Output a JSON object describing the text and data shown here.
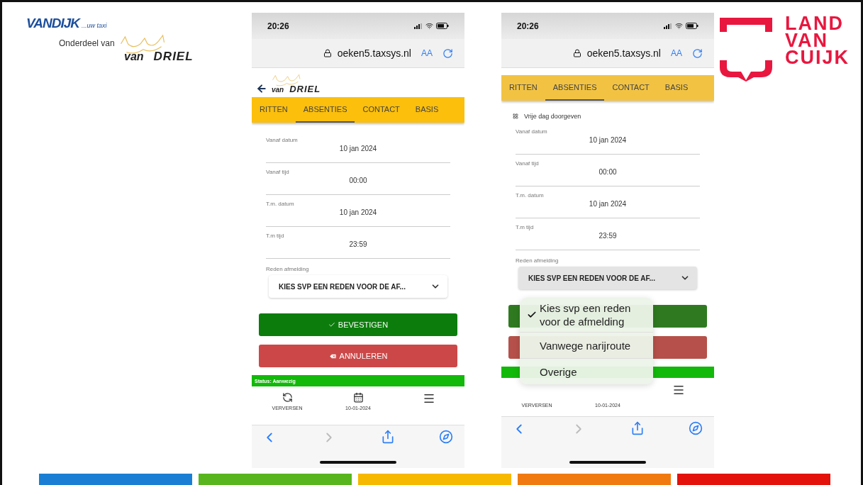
{
  "logo_left": {
    "brand": "VANDIJK",
    "tagline": "...uw taxi",
    "subtitle": "Onderdeel van",
    "partner_prefix": "van",
    "partner_name": "DRIEL"
  },
  "phones": [
    {
      "time": "20:26",
      "url": "oeken5.taxsys.nl",
      "text_size": "AA",
      "header": {
        "prefix": "van",
        "name": "DRIEL"
      },
      "tabs": [
        {
          "label": "RITTEN",
          "selected": false
        },
        {
          "label": "ABSENTIES",
          "selected": true
        },
        {
          "label": "CONTACT",
          "selected": false
        },
        {
          "label": "BASIS",
          "selected": false
        }
      ],
      "fields": [
        {
          "label": "Vanaf datum",
          "value": "10 jan 2024"
        },
        {
          "label": "Vanaf tijd",
          "value": "00:00"
        },
        {
          "label": "T.m. datum",
          "value": "10 jan 2024"
        },
        {
          "label": "T.m tijd",
          "value": "23:59"
        }
      ],
      "reason": {
        "label": "Reden afmelding",
        "value": "KIES SVP EEN REDEN VOOR DE AF...",
        "open": false
      },
      "buttons": [
        {
          "kind": "confirm",
          "label": "BEVESTIGEN"
        },
        {
          "kind": "cancel",
          "label": "ANNULEREN"
        }
      ],
      "status": "Status: Aanwezig",
      "toolbar": [
        {
          "kind": "refresh",
          "label": "VERVERSEN"
        },
        {
          "kind": "calendar",
          "label": "10-01-2024"
        },
        {
          "kind": "menu"
        }
      ]
    },
    {
      "time": "20:26",
      "url": "oeken5.taxsys.nl",
      "text_size": "AA",
      "tabs": [
        {
          "label": "RITTEN",
          "selected": false
        },
        {
          "label": "ABSENTIES",
          "selected": true
        },
        {
          "label": "CONTACT",
          "selected": false
        },
        {
          "label": "BASIS",
          "selected": false
        }
      ],
      "section_title": "Vrije dag doorgeven",
      "fields": [
        {
          "label": "Vanaf datum",
          "value": "10 jan 2024"
        },
        {
          "label": "Vanaf tijd",
          "value": "00:00"
        },
        {
          "label": "T.m. datum",
          "value": "10 jan 2024"
        },
        {
          "label": "T.m tijd",
          "value": "23:59"
        }
      ],
      "reason": {
        "label": "Reden afmelding",
        "value": "KIES SVP EEN REDEN VOOR DE AF...",
        "open": true
      },
      "buttons": [
        {
          "kind": "confirm"
        },
        {
          "kind": "cancel"
        }
      ],
      "toolbar": [
        {
          "kind": "text",
          "label": "VERVERSEN"
        },
        {
          "kind": "text",
          "label": "10-01-2024"
        },
        {
          "kind": "menu"
        }
      ],
      "menu": [
        {
          "label": "Kies svp een reden voor de afmelding",
          "selected": true
        },
        {
          "label": "Vanwege narijroute",
          "selected": false
        },
        {
          "label": "Overige",
          "selected": false
        }
      ]
    }
  ],
  "logo_right": {
    "lines": [
      "LAND",
      "VAN",
      "CUIJK"
    ]
  },
  "color_bars": [
    {
      "color": "#1a7fd4"
    },
    {
      "color": "#58b51e"
    },
    {
      "color": "#f7b800"
    },
    {
      "color": "#f07a10"
    },
    {
      "color": "#e3120b"
    }
  ]
}
